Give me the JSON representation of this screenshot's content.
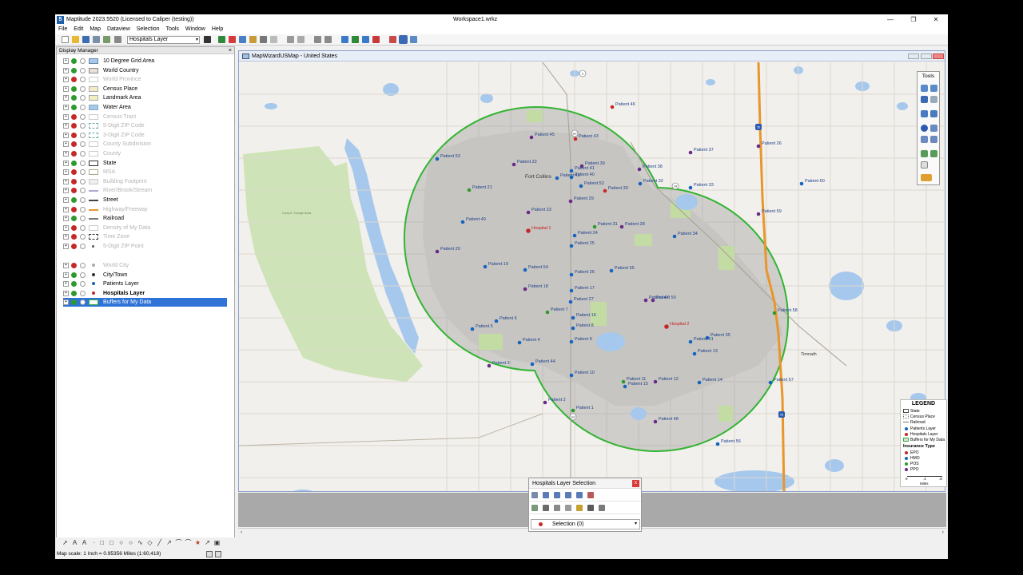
{
  "window": {
    "app_title": "Maptitude 2023.5520 (Licensed to Caliper (testing))",
    "doc_title": "Workspace1.wrkz",
    "minimize": "—",
    "maximize": "❐",
    "close": "✕"
  },
  "menu": [
    "File",
    "Edit",
    "Map",
    "Dataview",
    "Selection",
    "Tools",
    "Window",
    "Help"
  ],
  "toolbar": {
    "layer_select": "Hospitals Layer"
  },
  "display_manager": {
    "title": "Display Manager",
    "close": "×",
    "groups": [
      [
        {
          "name": "10 Degree Grid Area",
          "on": true
        },
        {
          "name": "World Country",
          "on": true
        },
        {
          "name": "World Province",
          "on": false
        },
        {
          "name": "Census Place",
          "on": true
        },
        {
          "name": "Landmark Area",
          "on": true
        },
        {
          "name": "Water Area",
          "on": true
        },
        {
          "name": "Census Tract",
          "on": false
        },
        {
          "name": "5-Digit ZIP Code",
          "on": false
        },
        {
          "name": "3-Digit ZIP Code",
          "on": false
        },
        {
          "name": "County Subdivision",
          "on": false
        },
        {
          "name": "County",
          "on": false
        },
        {
          "name": "State",
          "on": true
        },
        {
          "name": "MSA",
          "on": false
        },
        {
          "name": "Building Footprint",
          "on": false
        },
        {
          "name": "River/Brook/Stream",
          "on": false
        },
        {
          "name": "Street",
          "on": true
        },
        {
          "name": "Highway/Freeway",
          "on": false
        },
        {
          "name": "Railroad",
          "on": true
        },
        {
          "name": "Density of My Data",
          "on": false
        },
        {
          "name": "Time Zone",
          "on": false
        },
        {
          "name": "5-Digit ZIP Point",
          "on": false
        }
      ],
      [
        {
          "name": "World City",
          "on": false
        },
        {
          "name": "City/Town",
          "on": true
        },
        {
          "name": "Patients Layer",
          "on": true
        },
        {
          "name": "Hospitals Layer",
          "on": true,
          "bold": true
        },
        {
          "name": "Buffers for My Data",
          "on": true,
          "selected": true
        }
      ]
    ]
  },
  "map_window": {
    "title": "MapWizardUSMap - United States",
    "city_label": "Fort Collins",
    "town_label": "Timnath",
    "park_label": "Larry E. Dodge Area",
    "highway_shields": [
      "1",
      "25",
      "287",
      "14",
      "287",
      "25"
    ],
    "hospitals": [
      {
        "label": "Hospital 1"
      },
      {
        "label": "Hospital 2"
      }
    ],
    "patients": [
      "Patient 46",
      "Patient 45",
      "Patient 43",
      "Patient 37",
      "Patient 26",
      "Patient 53",
      "Patient 22",
      "Patient 39",
      "Patient 41",
      "Patient 38",
      "Patient 40",
      "Patient 42",
      "Patient 52",
      "Patient 32",
      "Patient 33",
      "Patient 60",
      "Patient 21",
      "Patient 30",
      "Patient 29",
      "Patient 23",
      "Patient 59",
      "Patient 49",
      "Patient 31",
      "Patient 28",
      "Patient 24",
      "Patient 34",
      "Patient 25",
      "Patient 20",
      "Patient 19",
      "Patient 54",
      "Patient 55",
      "Patient 26",
      "Patient 18",
      "Patient 17",
      "Patient 47",
      "Patient 50",
      "Patient 27",
      "Patient 7",
      "Patient 58",
      "Patient 6",
      "Patient 16",
      "Patient 5",
      "Patient 8",
      "Patient 35",
      "Patient 4",
      "Patient 9",
      "Patient 51",
      "Patient 13",
      "Patient 3",
      "Patient 44",
      "Patient 10",
      "Patient 11",
      "Patient 12",
      "Patient 14",
      "Patient 15",
      "Patient 57",
      "Patient 2",
      "Patient 1",
      "Patient 48",
      "Patient 56"
    ]
  },
  "tools_palette": {
    "title": "Tools"
  },
  "legend": {
    "title": "LEGEND",
    "items": [
      "State",
      "Census Place",
      "Railroad",
      "Patients Layer",
      "Hospitals Layer",
      "Buffers for My Data"
    ],
    "section": "Insurance Type",
    "types": [
      {
        "name": "EPO",
        "color": "#c62828"
      },
      {
        "name": "HMO",
        "color": "#1565c0"
      },
      {
        "name": "POS",
        "color": "#2e9a2e"
      },
      {
        "name": "PPO",
        "color": "#6a2a8a"
      }
    ],
    "scale_ticks": [
      "0",
      ".4",
      ".8"
    ],
    "scale_unit": "Miles"
  },
  "selection_panel": {
    "title": "Hospitals Layer Selection",
    "close": "x",
    "dropdown": "Selection (0)"
  },
  "status": {
    "scale_text": "Map scale: 1 Inch = 0.95356 Miles (1:60,418)"
  },
  "colors": {
    "buffer": "#32b432",
    "hospital": "#c62828",
    "selected_layer": "#2f73d6"
  }
}
